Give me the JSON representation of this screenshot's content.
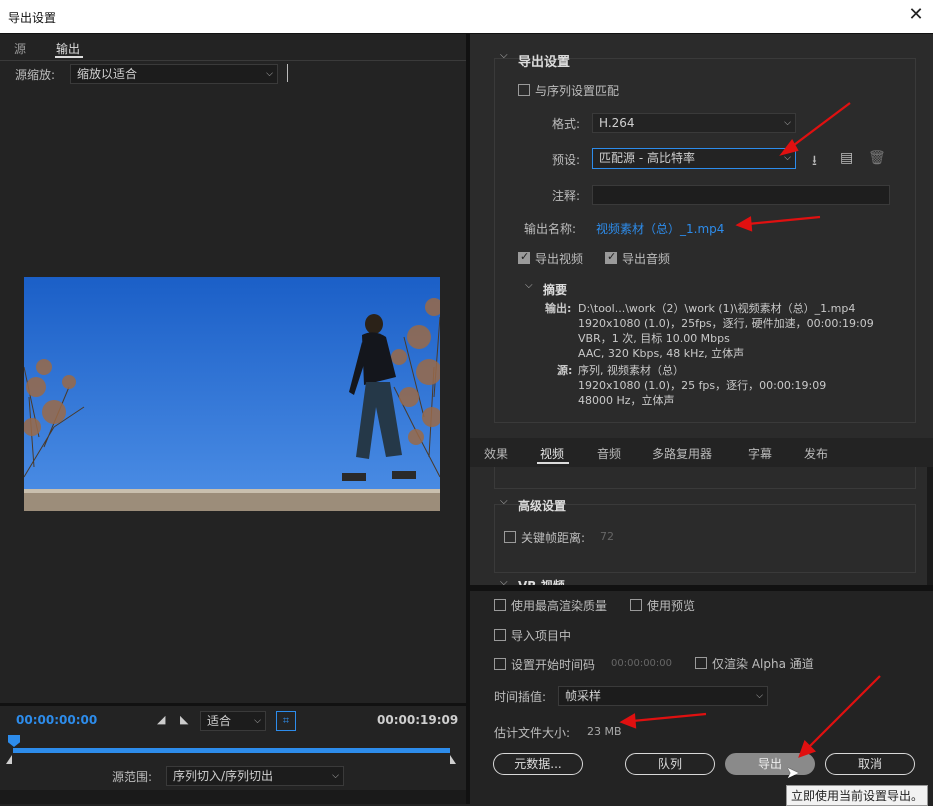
{
  "window": {
    "title": "导出设置",
    "close_glyph": "✕"
  },
  "left": {
    "tabs": [
      "源",
      "输出"
    ],
    "scale_label": "源缩放:",
    "scale_value": "缩放以适合",
    "timecode_start": "00:00:00:00",
    "fit_value": "适合",
    "timecode_end": "00:00:19:09",
    "range_label": "源范围:",
    "range_value": "序列切入/序列切出"
  },
  "export_settings": {
    "section_title": "导出设置",
    "match_sequence": "与序列设置匹配",
    "format_label": "格式:",
    "format_value": "H.264",
    "preset_label": "预设:",
    "preset_value": "匹配源 - 高比特率",
    "comment_label": "注释:",
    "comment_value": "",
    "output_name_label": "输出名称:",
    "output_name_value": "视频素材（总）_1.mp4",
    "export_video": "导出视频",
    "export_audio": "导出音频",
    "summary_title": "摘要",
    "output_key": "输出:",
    "output_lines": [
      "D:\\tool...\\work（2）\\work (1)\\视频素材（总）_1.mp4",
      "1920x1080 (1.0)，25fps，逐行, 硬件加速，00:00:19:09",
      "VBR，1 次, 目标 10.00 Mbps",
      "AAC, 320 Kbps, 48  kHz, 立体声"
    ],
    "source_key": "源:",
    "source_lines": [
      "序列, 视频素材（总）",
      "1920x1080 (1.0)，25 fps，逐行，00:00:19:09",
      "48000 Hz，立体声"
    ]
  },
  "tabs": [
    "效果",
    "视频",
    "音频",
    "多路复用器",
    "字幕",
    "发布"
  ],
  "active_tab": "视频",
  "advanced": {
    "title": "高级设置",
    "keyframe_label": "关键帧距离:",
    "keyframe_value": "72",
    "vr_title": "VR 视频"
  },
  "bottom": {
    "max_quality": "使用最高渲染质量",
    "use_preview": "使用预览",
    "import_project": "导入项目中",
    "set_timecode": "设置开始时间码",
    "timecode_value": "00:00:00:00",
    "alpha_only": "仅渲染 Alpha 通道",
    "interp_label": "时间插值:",
    "interp_value": "帧采样",
    "filesize_label": "估计文件大小:",
    "filesize_value": "23 MB",
    "metadata_btn": "元数据...",
    "queue_btn": "队列",
    "export_btn": "导出",
    "cancel_btn": "取消",
    "tooltip": "立即使用当前设置导出。"
  },
  "colors": {
    "accent": "#2d8ceb",
    "annotation": "#e01010"
  }
}
